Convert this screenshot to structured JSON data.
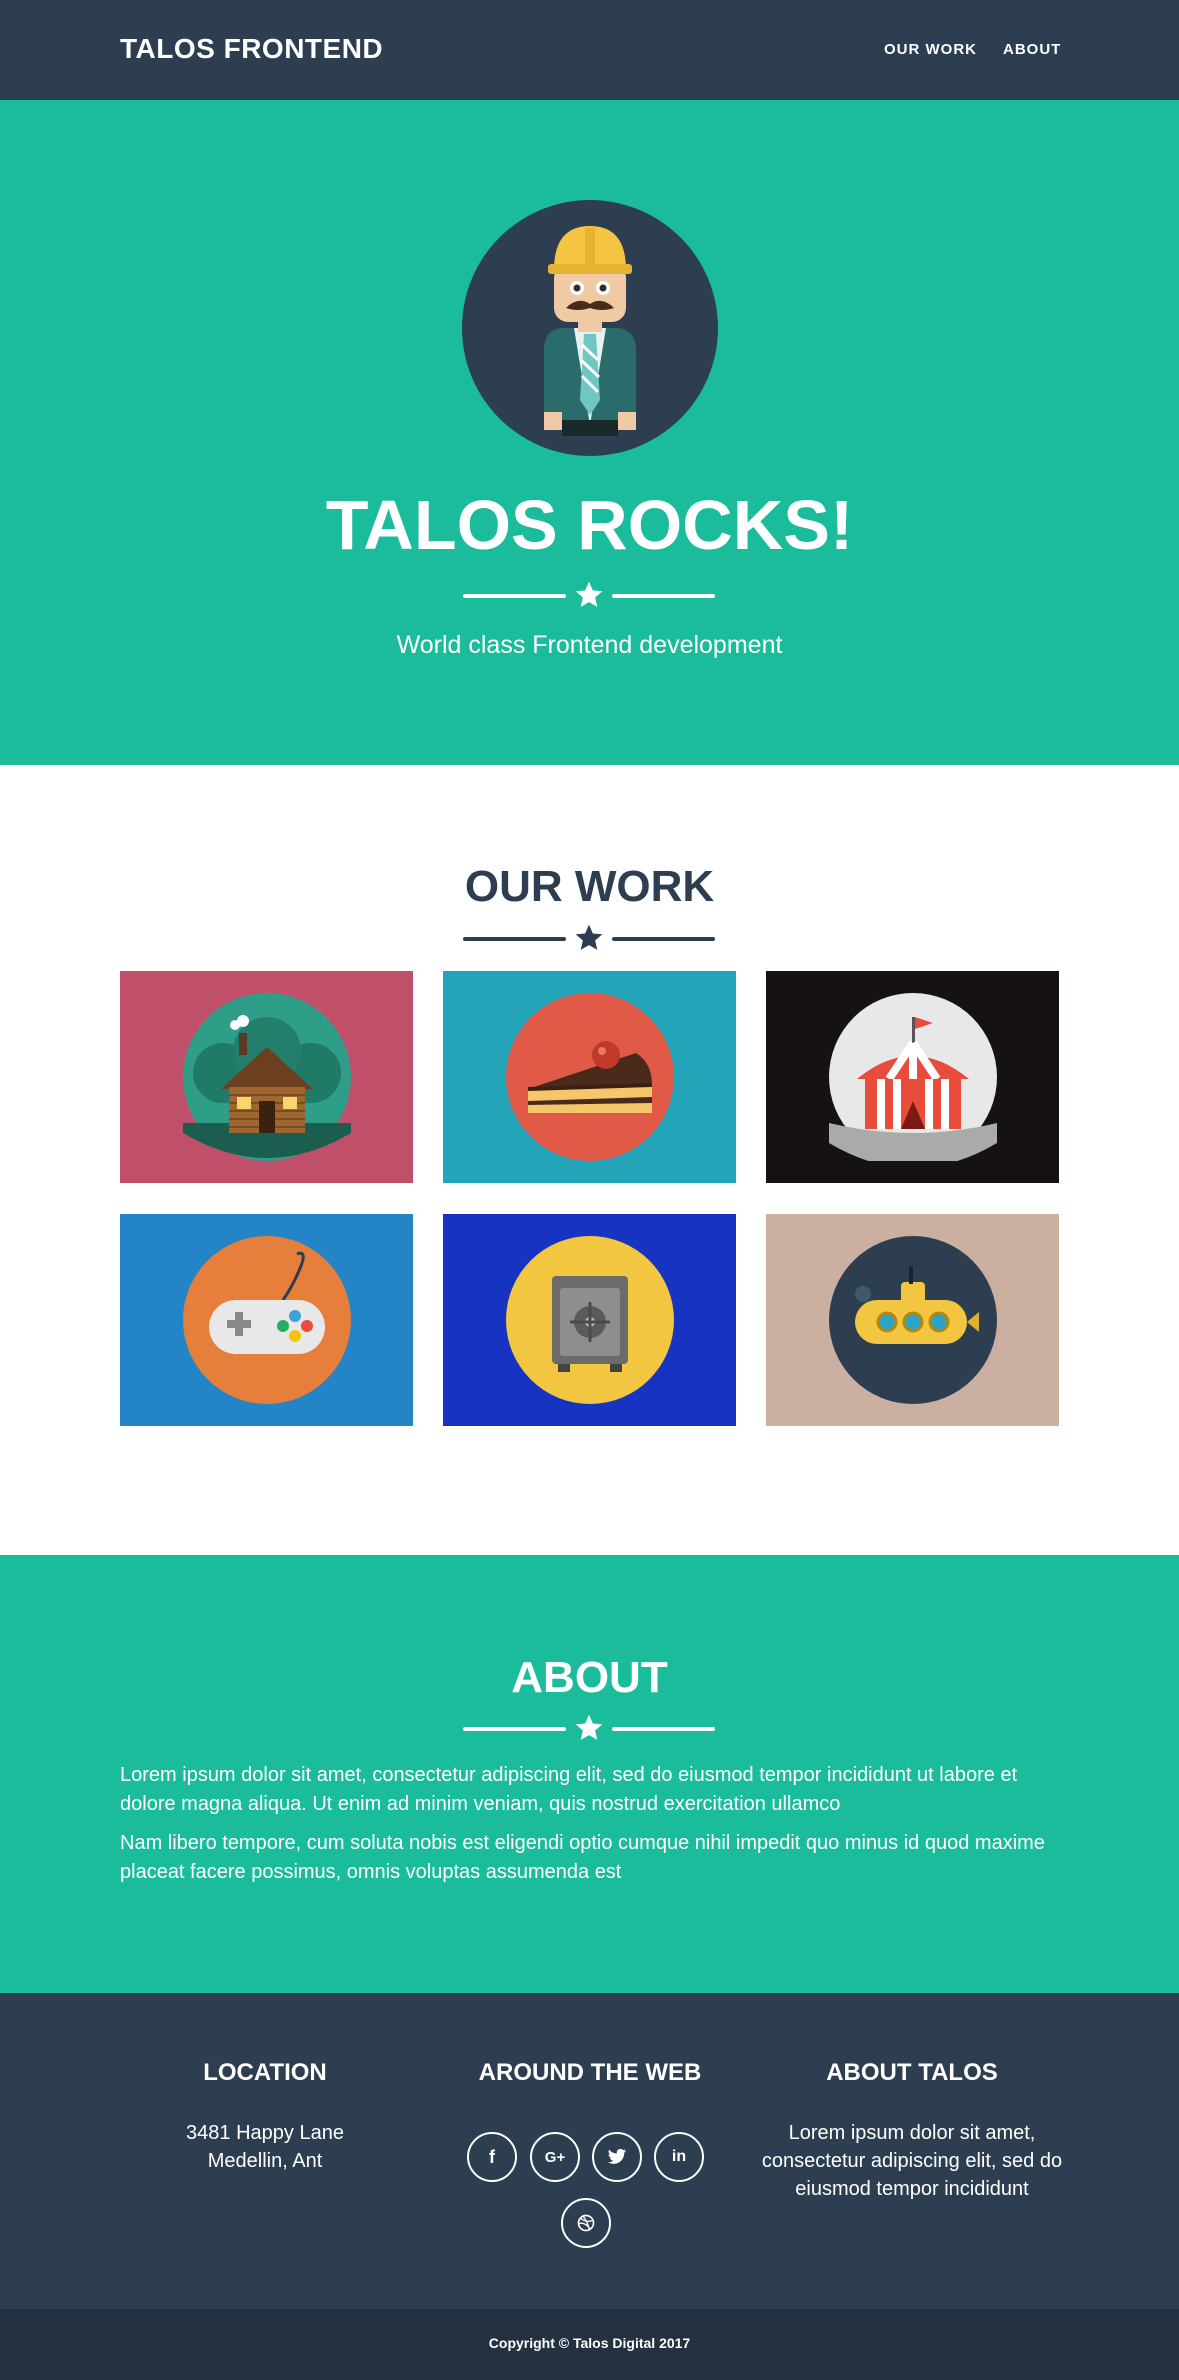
{
  "nav": {
    "brand": "TALOS FRONTEND",
    "links": [
      "OUR WORK",
      "ABOUT"
    ]
  },
  "hero": {
    "title": "TALOS ROCKS!",
    "subtitle": "World class Frontend development",
    "avatar_icon": "construction-worker-avatar-icon"
  },
  "work": {
    "title": "OUR WORK",
    "items": [
      {
        "icon": "cabin-icon",
        "bg": "#c0506a"
      },
      {
        "icon": "cake-icon",
        "bg": "#23a4b9"
      },
      {
        "icon": "circus-tent-icon",
        "bg": "#161211"
      },
      {
        "icon": "game-controller-icon",
        "bg": "#2384c6"
      },
      {
        "icon": "safe-icon",
        "bg": "#1634c1"
      },
      {
        "icon": "submarine-icon",
        "bg": "#cbb0a2"
      }
    ]
  },
  "about": {
    "title": "ABOUT",
    "paragraphs": [
      "Lorem ipsum dolor sit amet, consectetur adipiscing elit, sed do eiusmod tempor incididunt ut labore et dolore magna aliqua. Ut enim ad minim veniam, quis nostrud exercitation ullamco",
      "Nam libero tempore, cum soluta nobis est eligendi optio cumque nihil impedit quo minus id quod maxime placeat facere possimus, omnis voluptas assumenda est"
    ]
  },
  "footer": {
    "location": {
      "title": "LOCATION",
      "line1": "3481 Happy Lane",
      "line2": "Medellin, Ant"
    },
    "web": {
      "title": "AROUND THE WEB",
      "icons": [
        "facebook-icon",
        "google-plus-icon",
        "twitter-icon",
        "linkedin-icon",
        "dribbble-icon"
      ]
    },
    "about": {
      "title": "ABOUT TALOS",
      "text": "Lorem ipsum dolor sit amet, consectetur adipiscing elit, sed do eiusmod tempor incididunt"
    }
  },
  "copyright": "Copyright © Talos Digital 2017",
  "colors": {
    "primary": "#1abc9c",
    "dark": "#2c3e50",
    "darker": "#233140"
  }
}
